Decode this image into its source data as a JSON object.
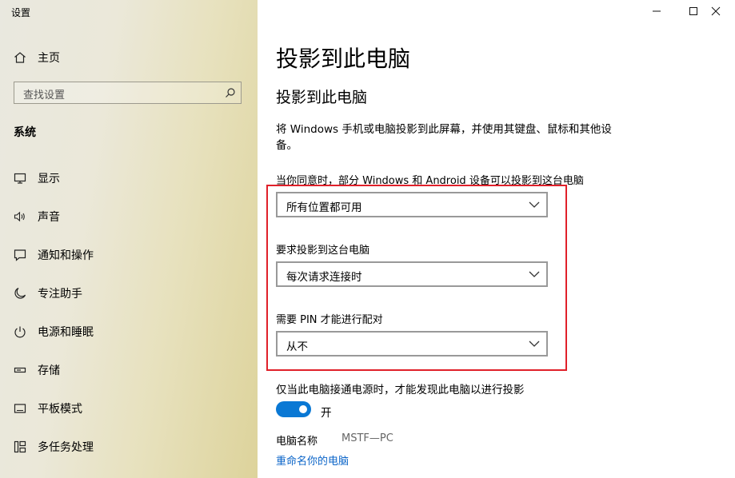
{
  "window": {
    "title": "设置",
    "controls": [
      "minimize-icon",
      "maximize-icon",
      "close-icon"
    ]
  },
  "sidebar": {
    "home_label": "主页",
    "search_placeholder": "查找设置",
    "section_title": "系统",
    "items": [
      {
        "label": "显示",
        "icon": "display-icon"
      },
      {
        "label": "声音",
        "icon": "speaker-icon"
      },
      {
        "label": "通知和操作",
        "icon": "notification-icon"
      },
      {
        "label": "专注助手",
        "icon": "moon-icon"
      },
      {
        "label": "电源和睡眠",
        "icon": "power-icon"
      },
      {
        "label": "存储",
        "icon": "storage-icon"
      },
      {
        "label": "平板模式",
        "icon": "tablet-icon"
      },
      {
        "label": "多任务处理",
        "icon": "multitask-icon"
      }
    ]
  },
  "main": {
    "title": "投影到此电脑",
    "subtitle": "投影到此电脑",
    "description": "将 Windows 手机或电脑投影到此屏幕，并使用其键盘、鼠标和其他设备。",
    "availability": {
      "label": "当你同意时，部分 Windows 和 Android 设备可以投影到这台电脑",
      "value": "所有位置都可用"
    },
    "ask": {
      "label": "要求投影到这台电脑",
      "value": "每次请求连接时"
    },
    "pin": {
      "label": "需要 PIN 才能进行配对",
      "value": "从不"
    },
    "power": {
      "label": "仅当此电脑接通电源时，才能发现此电脑以进行投影",
      "toggle_state": "开",
      "on": true
    },
    "pc_name": {
      "label": "电脑名称",
      "value": "MSTF—PC"
    },
    "rename_link": "重命名你的电脑"
  },
  "colors": {
    "accent": "#0a78d4",
    "highlight_border": "#e0202a",
    "link": "#0a64c8"
  }
}
